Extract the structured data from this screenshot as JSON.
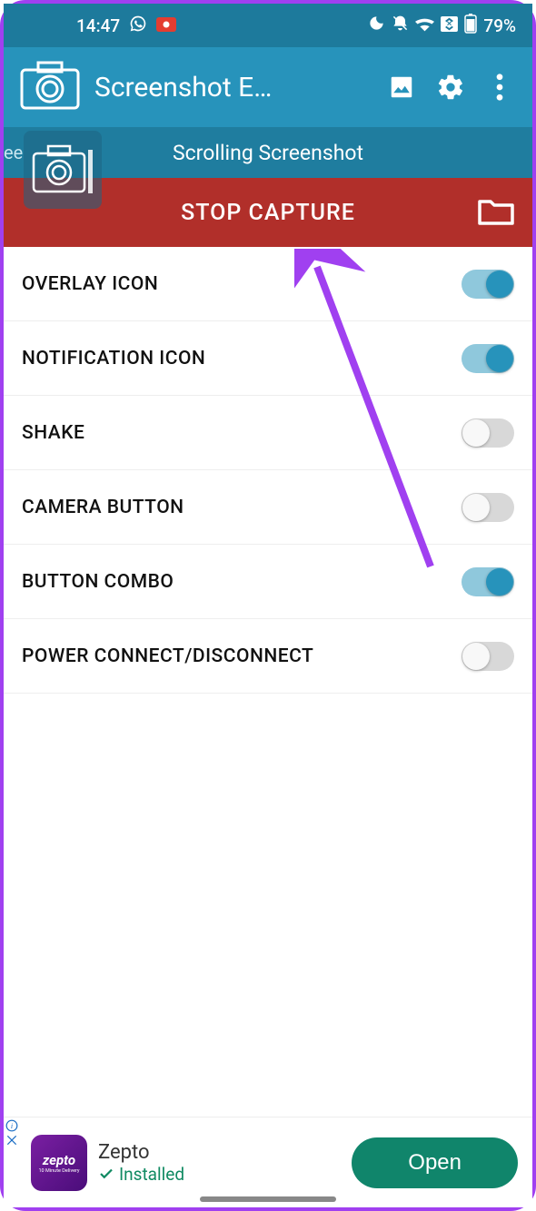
{
  "status": {
    "time": "14:47",
    "battery": "79%"
  },
  "appbar": {
    "title": "Screenshot E…"
  },
  "subheader": {
    "title": "Scrolling Screenshot",
    "left_fragment": "ee"
  },
  "stopbar": {
    "label": "STOP CAPTURE"
  },
  "settings": [
    {
      "label": "OVERLAY ICON",
      "on": true
    },
    {
      "label": "NOTIFICATION ICON",
      "on": true
    },
    {
      "label": "SHAKE",
      "on": false
    },
    {
      "label": "CAMERA BUTTON",
      "on": false
    },
    {
      "label": "BUTTON COMBO",
      "on": true
    },
    {
      "label": "POWER CONNECT/DISCONNECT",
      "on": false
    }
  ],
  "ad": {
    "icon_brand": "zepto",
    "icon_sub": "10 Minute Delivery",
    "title": "Zepto",
    "status": "Installed",
    "cta": "Open"
  }
}
